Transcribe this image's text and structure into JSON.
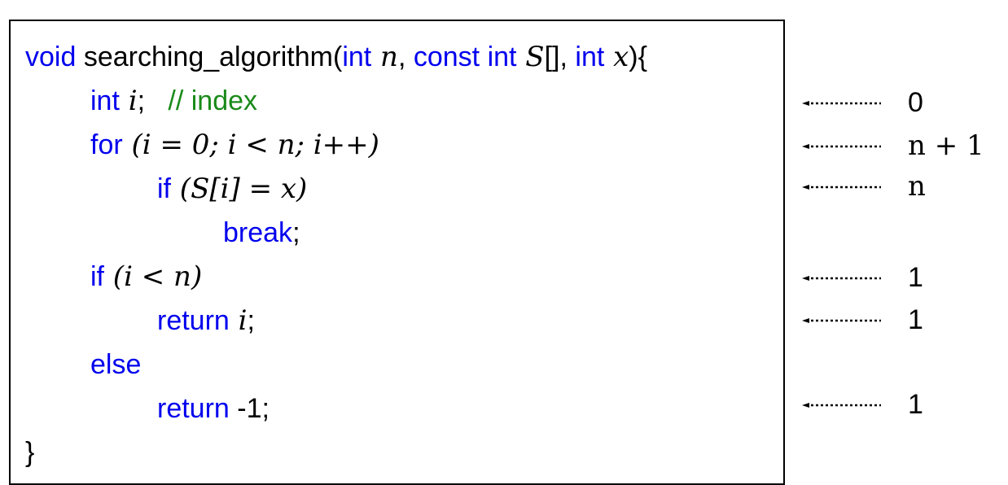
{
  "code": {
    "line1": {
      "kw_void": "void",
      "fname": " searching_algorithm(",
      "kw_int1": "int",
      "var_n": " n",
      "comma1": ", ",
      "kw_const_int": "const int",
      "var_S": " S",
      "brackets": "[], ",
      "kw_int2": "int",
      "var_x": " x",
      "close": "){"
    },
    "line2": {
      "kw_int": "int",
      "var_i": " i",
      "semi": ";   ",
      "comment": "// index"
    },
    "line3": {
      "kw_for": "for",
      "expr": " (i = 0; i < n; i++)"
    },
    "line4": {
      "kw_if": "if",
      "expr": " (S[i] = x)"
    },
    "line5": {
      "kw_break": "break",
      "semi": ";"
    },
    "line6": {
      "kw_if": "if",
      "expr": " (i < n)"
    },
    "line7": {
      "kw_return": "return",
      "var_i": " i",
      "semi": ";"
    },
    "line8": {
      "kw_else": "else"
    },
    "line9": {
      "kw_return": "return",
      "rest": " -1;"
    },
    "line10": {
      "brace": "}"
    }
  },
  "annotations": {
    "count_int_i": "0",
    "count_for": "n + 1",
    "count_if": "n",
    "count_if_i_lt_n": "1",
    "count_return_i": "1",
    "count_return_minus1": "1"
  },
  "colors": {
    "keyword": "#0000ee",
    "comment": "#1a8a1a",
    "text": "#000000"
  },
  "icons": {
    "annotation_arrow": "dotted-left-arrow-icon"
  }
}
